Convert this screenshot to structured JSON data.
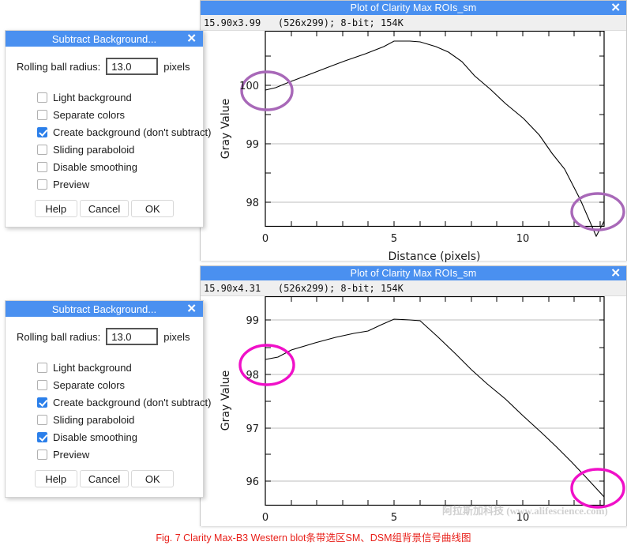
{
  "background_color": "#ffffff",
  "accent_color": "#4a90f0",
  "plot_windows": [
    {
      "title": "Plot of Clarity Max ROIs_sm",
      "close_label": "✕",
      "info": "15.90x3.99   (526x299); 8-bit; 154K",
      "highlight_color": "#a868b8"
    },
    {
      "title": "Plot of Clarity Max ROIs_sm",
      "close_label": "✕",
      "info": "15.90x4.31   (526x299); 8-bit; 154K",
      "highlight_color": "#f010c8"
    }
  ],
  "dialogs": [
    {
      "title": "Subtract Background...",
      "close_label": "✕",
      "radius_label": "Rolling ball radius:",
      "radius_value": "13.0",
      "radius_placeholder": "13.0",
      "radius_unit": "pixels",
      "checkboxes": [
        {
          "label": "Light background",
          "checked": false
        },
        {
          "label": "Separate colors",
          "checked": false
        },
        {
          "label": "Create background (don't subtract)",
          "checked": true
        },
        {
          "label": "Sliding paraboloid",
          "checked": false
        },
        {
          "label": "Disable smoothing",
          "checked": false
        },
        {
          "label": "Preview",
          "checked": false
        }
      ],
      "buttons": [
        "Help",
        "Cancel",
        "OK"
      ]
    },
    {
      "title": "Subtract Background...",
      "close_label": "✕",
      "radius_label": "Rolling ball radius:",
      "radius_value": "13.0",
      "radius_placeholder": "13.0",
      "radius_unit": "pixels",
      "checkboxes": [
        {
          "label": "Light background",
          "checked": false
        },
        {
          "label": "Separate colors",
          "checked": false
        },
        {
          "label": "Create background (don't subtract)",
          "checked": true
        },
        {
          "label": "Sliding paraboloid",
          "checked": false
        },
        {
          "label": "Disable smoothing",
          "checked": true
        },
        {
          "label": "Preview",
          "checked": false
        }
      ],
      "buttons": [
        "Help",
        "Cancel",
        "OK"
      ]
    }
  ],
  "caption": "Fig. 7 Clarity Max-B3 Western blot条带选区SM、DSM组背景信号曲线图",
  "watermark": "阿拉斯加科技 (www.alifescience.com)",
  "chart_data": [
    {
      "type": "line",
      "title": "Plot of Clarity Max ROIs_sm",
      "xlabel": "Distance (pixels)",
      "ylabel": "Gray Value",
      "xlim": [
        0,
        13.1
      ],
      "ylim": [
        97.72,
        100.6
      ],
      "xticks": [
        0,
        5,
        10
      ],
      "xtick_labels": [
        "0",
        "5",
        "10"
      ],
      "yticks": [
        98,
        99,
        100
      ],
      "ytick_labels": [
        "98",
        "99",
        "100"
      ],
      "grid": true,
      "legend": "none",
      "x": [
        0,
        0.4,
        0.9,
        1.8,
        2.6,
        3.1,
        3.9,
        4.6,
        5.0,
        5.6,
        6.0,
        6.6,
        7.1,
        7.6,
        8.1,
        8.7,
        9.3,
        10.0,
        10.6,
        11.1,
        11.6,
        12.2,
        12.8,
        13.1
      ],
      "y": [
        99.92,
        99.95,
        100.02,
        100.15,
        100.27,
        100.33,
        100.42,
        100.52,
        100.59,
        100.59,
        100.58,
        100.52,
        100.45,
        100.32,
        100.14,
        99.96,
        99.78,
        99.58,
        99.36,
        99.12,
        98.92,
        98.52,
        98.05,
        97.74
      ],
      "annotations": [
        {
          "kind": "ellipse",
          "shape_color": "#a868b8",
          "at_x": 0.0,
          "at_y": 100.0,
          "note": "start-point highlight around y=100 tick"
        },
        {
          "kind": "ellipse",
          "shape_color": "#a868b8",
          "at_x": 12.9,
          "at_y": 97.85,
          "note": "end-point highlight at curve tail"
        }
      ]
    },
    {
      "type": "line",
      "title": "Plot of Clarity Max ROIs_sm",
      "xlabel": "Distance (pixels)",
      "ylabel": "Gray Value",
      "xlim": [
        0,
        13.1
      ],
      "ylim": [
        95.72,
        99.18
      ],
      "xticks": [
        0,
        5,
        10
      ],
      "xtick_labels": [
        "0",
        "5",
        "10"
      ],
      "yticks": [
        96,
        97,
        98,
        99
      ],
      "ytick_labels": [
        "96",
        "97",
        "98",
        "99"
      ],
      "grid": true,
      "legend": "none",
      "x": [
        0,
        0.5,
        1.0,
        1.9,
        2.7,
        3.4,
        4.0,
        4.5,
        5.0,
        5.6,
        6.0,
        6.7,
        7.4,
        8.0,
        8.6,
        9.3,
        10.0,
        10.7,
        11.3,
        11.9,
        12.4,
        13.1
      ],
      "y": [
        98.33,
        98.37,
        98.5,
        98.63,
        98.73,
        98.81,
        98.86,
        98.98,
        99.07,
        99.06,
        99.05,
        98.75,
        98.42,
        98.12,
        97.86,
        97.58,
        97.27,
        96.96,
        96.69,
        96.4,
        96.14,
        95.75
      ],
      "annotations": [
        {
          "kind": "ellipse",
          "shape_color": "#f010c8",
          "at_x": 0.0,
          "at_y": 98.2,
          "note": "start-point highlight around y=98 tick"
        },
        {
          "kind": "ellipse",
          "shape_color": "#f010c8",
          "at_x": 12.9,
          "at_y": 95.9,
          "note": "end-point highlight at curve tail"
        }
      ]
    }
  ]
}
